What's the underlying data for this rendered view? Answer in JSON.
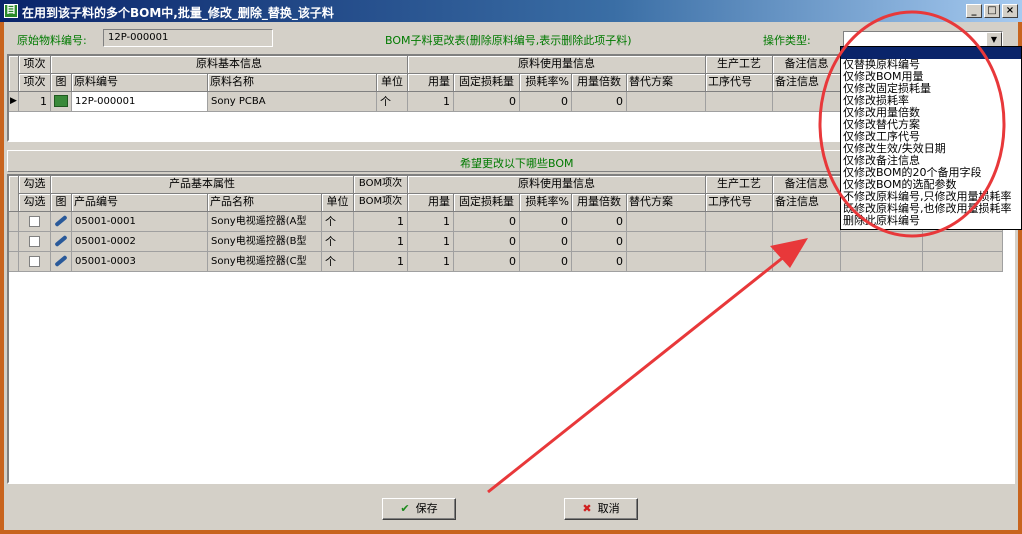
{
  "window": {
    "title": "在用到该子料的多个BOM中,批量_修改_删除_替换_该子料",
    "controls": [
      "_",
      "□",
      "×"
    ]
  },
  "top": {
    "orig_label": "原始物料编号:",
    "orig_value": "12P-000001",
    "table_title": "BOM子料更改表(删除原料编号,表示删除此项子料)",
    "optype_label": "操作类型:",
    "optype_value": ""
  },
  "grid1": {
    "group_headers": [
      "项次",
      "原料基本信息",
      "原料使用量信息",
      "生产工艺",
      "备注信息"
    ],
    "headers": [
      "项次",
      "图",
      "原料编号",
      "原料名称",
      "单位",
      "用量",
      "固定损耗量",
      "损耗率%",
      "用量倍数",
      "替代方案",
      "工序代号",
      "备注信息"
    ],
    "rows": [
      {
        "ind": "▶",
        "idx": "1",
        "img": "pcb",
        "code": "12P-000001",
        "name": "Sony PCBA",
        "unit": "个",
        "qty": "1",
        "fixloss": "0",
        "lossrate": "0",
        "mult": "0",
        "alt": "",
        "proc": "",
        "memo": ""
      }
    ]
  },
  "section2": {
    "title": "希望更改以下哪些BOM"
  },
  "grid2": {
    "group_headers": [
      "勾选",
      "产品基本属性",
      "BOM项次",
      "原料使用量信息",
      "生产工艺",
      "备注信息"
    ],
    "headers": [
      "勾选",
      "图",
      "产品编号",
      "产品名称",
      "单位",
      "BOM项次",
      "用量",
      "固定损耗量",
      "损耗率%",
      "用量倍数",
      "替代方案",
      "工序代号",
      "备注信息"
    ],
    "rows": [
      {
        "code": "05001-0001",
        "name": "Sony电视遥控器(A型",
        "unit": "个",
        "bomidx": "1",
        "qty": "1",
        "fixloss": "0",
        "lossrate": "0",
        "mult": "0"
      },
      {
        "code": "05001-0002",
        "name": "Sony电视遥控器(B型",
        "unit": "个",
        "bomidx": "1",
        "qty": "1",
        "fixloss": "0",
        "lossrate": "0",
        "mult": "0"
      },
      {
        "code": "05001-0003",
        "name": "Sony电视遥控器(C型",
        "unit": "个",
        "bomidx": "1",
        "qty": "1",
        "fixloss": "0",
        "lossrate": "0",
        "mult": "0"
      }
    ]
  },
  "dropdown": {
    "options": [
      "",
      "仅替换原料编号",
      "仅修改BOM用量",
      "仅修改固定损耗量",
      "仅修改损耗率",
      "仅修改用量倍数",
      "仅修改替代方案",
      "仅修改工序代号",
      "仅修改生效/失效日期",
      "仅修改备注信息",
      "仅修改BOM的20个备用字段",
      "仅修改BOM的选配参数",
      "不修改原料编号,只修改用量损耗率",
      "既修改原料编号,也修改用量损耗率",
      "删除此原料编号"
    ]
  },
  "buttons": {
    "save": "保存",
    "cancel": "取消"
  },
  "colors": {
    "title_bar": "#0a246a",
    "frame": "#c8641e",
    "green_label": "#007a00",
    "annotation": "#e8383a"
  }
}
